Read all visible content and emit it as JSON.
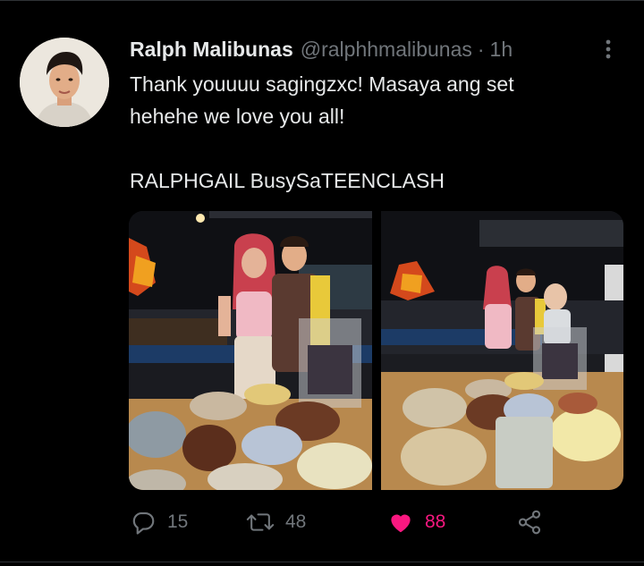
{
  "tweet": {
    "author": {
      "display_name": "Ralph Malibunas",
      "handle": "@ralphhmalibunas",
      "separator": "·",
      "time": "1h"
    },
    "text_lines": [
      "Thank youuuu sagingzxc! Masaya ang set",
      "hehehe we love you all!",
      "",
      "RALPHGAIL BusySaTEENCLASH"
    ],
    "media": [
      {
        "kind": "photo"
      },
      {
        "kind": "photo"
      }
    ],
    "actions": {
      "reply": {
        "icon": "reply-icon",
        "count": "15"
      },
      "retweet": {
        "icon": "retweet-icon",
        "count": "48"
      },
      "like": {
        "icon": "heart-icon",
        "count": "88",
        "liked": true,
        "color": "#f91880"
      },
      "share": {
        "icon": "share-icon"
      }
    }
  },
  "theme": {
    "background": "#000000",
    "text": "#e7e9ea",
    "secondary": "#71767b",
    "like_pink": "#f91880",
    "divider": "#2f3336"
  }
}
